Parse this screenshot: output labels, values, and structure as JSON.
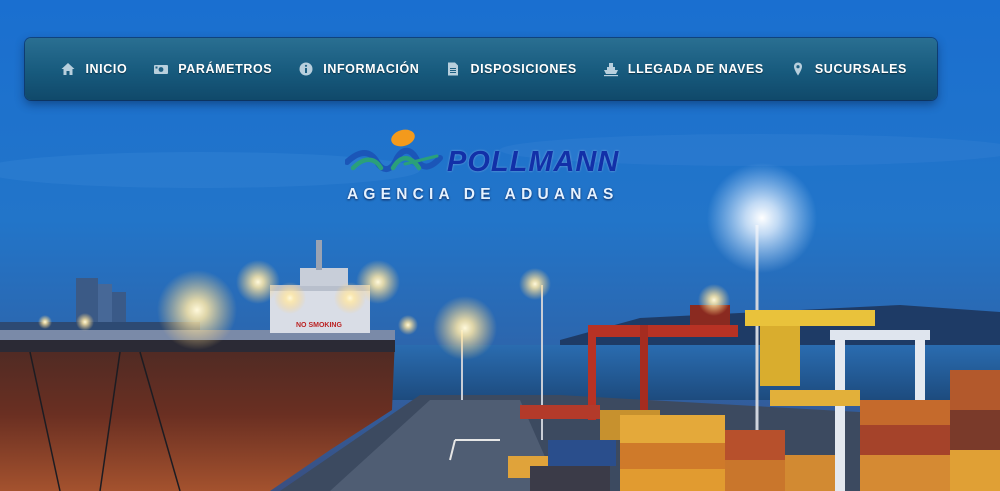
{
  "nav": {
    "items": [
      {
        "label": "INICIO",
        "icon": "home-icon"
      },
      {
        "label": "PARÁMETROS",
        "icon": "money-bill-icon"
      },
      {
        "label": "INFORMACIÓN",
        "icon": "info-circle-icon"
      },
      {
        "label": "DISPOSICIONES",
        "icon": "document-icon"
      },
      {
        "label": "LLEGADA DE NAVES",
        "icon": "ship-icon"
      },
      {
        "label": "SUCURSALES",
        "icon": "map-pin-icon"
      }
    ]
  },
  "logo": {
    "wordmark": "POLLMANN",
    "subtitle": "AGENCIA DE ADUANAS"
  },
  "ship": {
    "sign": "NO SMOKING"
  },
  "colors": {
    "nav_bg": "#175a7d",
    "logo_blue": "#1230a8",
    "logo_orange": "#f39a1c",
    "logo_green": "#2aa07a",
    "sky": "#1a5fb0"
  }
}
